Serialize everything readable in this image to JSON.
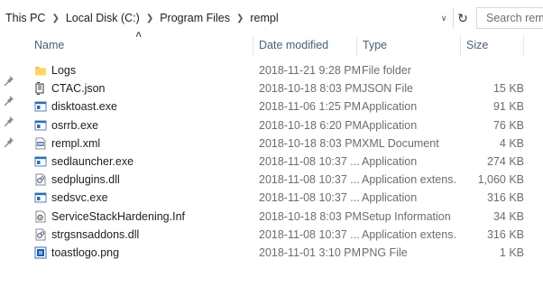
{
  "breadcrumb": [
    "This PC",
    "Local Disk (C:)",
    "Program Files",
    "rempl"
  ],
  "search": {
    "placeholder": "Search rempl"
  },
  "columns": {
    "name": "Name",
    "date": "Date modified",
    "type": "Type",
    "size": "Size"
  },
  "files": [
    {
      "name": "Logs",
      "date": "2018-11-21 9:28 PM",
      "type": "File folder",
      "size": "",
      "icon": "folder-icon"
    },
    {
      "name": "CTAC.json",
      "date": "2018-10-18 8:03 PM",
      "type": "JSON File",
      "size": "15 KB",
      "icon": "json-file-icon"
    },
    {
      "name": "disktoast.exe",
      "date": "2018-11-06 1:25 PM",
      "type": "Application",
      "size": "91 KB",
      "icon": "exe-icon"
    },
    {
      "name": "osrrb.exe",
      "date": "2018-10-18 6:20 PM",
      "type": "Application",
      "size": "76 KB",
      "icon": "exe-icon"
    },
    {
      "name": "rempl.xml",
      "date": "2018-10-18 8:03 PM",
      "type": "XML Document",
      "size": "4 KB",
      "icon": "xml-file-icon"
    },
    {
      "name": "sedlauncher.exe",
      "date": "2018-11-08 10:37 ...",
      "type": "Application",
      "size": "274 KB",
      "icon": "exe-icon"
    },
    {
      "name": "sedplugins.dll",
      "date": "2018-11-08 10:37 ...",
      "type": "Application extens...",
      "size": "1,060 KB",
      "icon": "dll-icon"
    },
    {
      "name": "sedsvc.exe",
      "date": "2018-11-08 10:37 ...",
      "type": "Application",
      "size": "316 KB",
      "icon": "exe-icon"
    },
    {
      "name": "ServiceStackHardening.Inf",
      "date": "2018-10-18 8:03 PM",
      "type": "Setup Information",
      "size": "34 KB",
      "icon": "inf-file-icon"
    },
    {
      "name": "strgsnsaddons.dll",
      "date": "2018-11-08 10:37 ...",
      "type": "Application extens...",
      "size": "316 KB",
      "icon": "dll-icon"
    },
    {
      "name": "toastlogo.png",
      "date": "2018-11-01 3:10 PM",
      "type": "PNG File",
      "size": "1 KB",
      "icon": "png-file-icon"
    }
  ]
}
